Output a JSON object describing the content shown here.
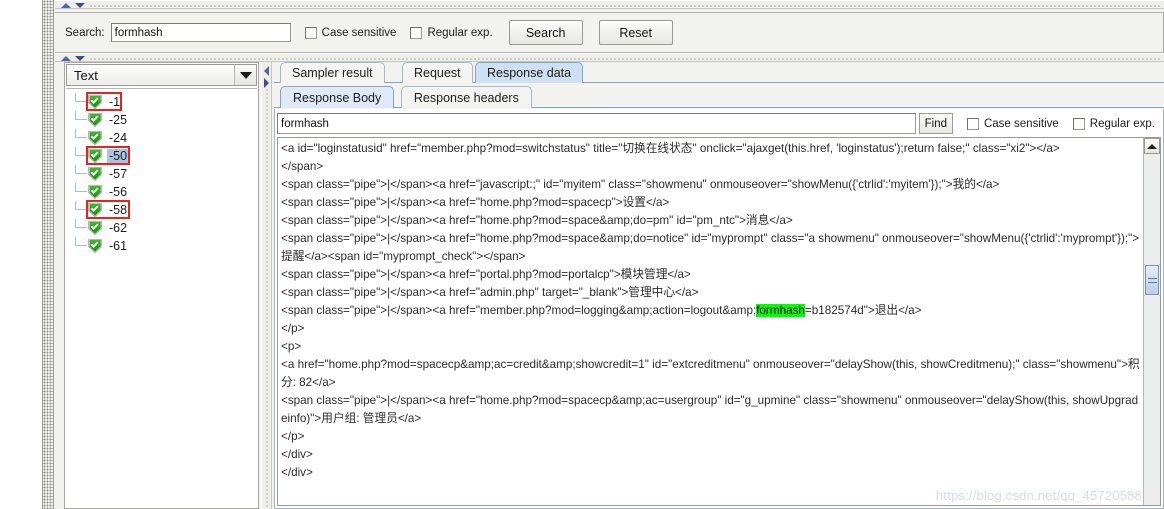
{
  "search_panel": {
    "label": "Search:",
    "value": "formhash",
    "placeholder": "",
    "case_sensitive_label": "Case sensitive",
    "regular_exp_label": "Regular exp.",
    "search_button": "Search",
    "reset_button": "Reset"
  },
  "tree": {
    "combo_value": "Text",
    "combo_icon": "chevron-down-icon",
    "items": [
      {
        "label": "-1",
        "icon": "green-shield-check-icon",
        "highlighted": true,
        "selected": false
      },
      {
        "label": "-25",
        "icon": "green-shield-check-icon",
        "highlighted": false,
        "selected": false
      },
      {
        "label": "-24",
        "icon": "green-shield-check-icon",
        "highlighted": false,
        "selected": false
      },
      {
        "label": "-50",
        "icon": "green-shield-check-icon",
        "highlighted": true,
        "selected": true
      },
      {
        "label": "-57",
        "icon": "green-shield-check-icon",
        "highlighted": false,
        "selected": false
      },
      {
        "label": "-56",
        "icon": "green-shield-check-icon",
        "highlighted": false,
        "selected": false
      },
      {
        "label": "-58",
        "icon": "green-shield-check-icon",
        "highlighted": true,
        "selected": false
      },
      {
        "label": "-62",
        "icon": "green-shield-check-icon",
        "highlighted": false,
        "selected": false
      },
      {
        "label": "-61",
        "icon": "green-shield-check-icon",
        "highlighted": false,
        "selected": false
      }
    ]
  },
  "main_tabs": [
    {
      "label": "Sampler result",
      "active": false
    },
    {
      "label": "Request",
      "active": false
    },
    {
      "label": "Response data",
      "active": true
    }
  ],
  "sub_tabs": [
    {
      "label": "Response Body",
      "active": true
    },
    {
      "label": "Response headers",
      "active": false
    }
  ],
  "find_bar": {
    "value": "formhash",
    "find_button": "Find",
    "case_sensitive_label": "Case sensitive",
    "regular_exp_label": "Regular exp."
  },
  "response_body": {
    "highlight_term": "formhash",
    "highlight_color": "#00ff00",
    "lines": [
      "<a id=\"loginstatusid\" href=\"member.php?mod=switchstatus\" title=\"切换在线状态\" onclick=\"ajaxget(this.href, 'loginstatus');return false;\" class=\"xi2\"></a>",
      "</span>",
      "<span class=\"pipe\">|</span><a href=\"javascript:;\" id=\"myitem\" class=\"showmenu\" onmouseover=\"showMenu({'ctrlid':'myitem'});\">我的</a>",
      "<span class=\"pipe\">|</span><a href=\"home.php?mod=spacecp\">设置</a>",
      "<span class=\"pipe\">|</span><a href=\"home.php?mod=space&amp;do=pm\" id=\"pm_ntc\">消息</a>",
      "<span class=\"pipe\">|</span><a href=\"home.php?mod=space&amp;do=notice\" id=\"myprompt\" class=\"a showmenu\" onmouseover=\"showMenu({'ctrlid':'myprompt'});\">提醒</a><span id=\"myprompt_check\"></span>",
      "<span class=\"pipe\">|</span><a href=\"portal.php?mod=portalcp\">模块管理</a>",
      "<span class=\"pipe\">|</span><a href=\"admin.php\" target=\"_blank\">管理中心</a>",
      "<span class=\"pipe\">|</span><a href=\"member.php?mod=logging&amp;action=logout&amp;formhash=b182574d\">退出</a>",
      "</p>",
      "<p>",
      "<a href=\"home.php?mod=spacecp&amp;ac=credit&amp;showcredit=1\" id=\"extcreditmenu\" onmouseover=\"delayShow(this, showCreditmenu);\" class=\"showmenu\">积分: 82</a>",
      "<span class=\"pipe\">|</span><a href=\"home.php?mod=spacecp&amp;ac=usergroup\" id=\"g_upmine\" class=\"showmenu\" onmouseover=\"delayShow(this, showUpgradeinfo)\">用户组: 管理员</a>",
      "</p>",
      "</div>",
      "</div>"
    ]
  },
  "watermark": "https://blog.csdn.net/qq_45720588"
}
